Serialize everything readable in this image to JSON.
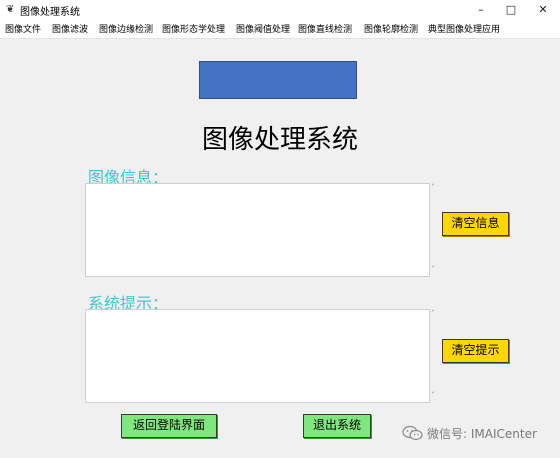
{
  "window": {
    "title": "图像处理系统",
    "icon": "feather-icon",
    "controls": {
      "minimize": "–",
      "maximize": "□",
      "close": "✕"
    }
  },
  "menu": [
    "图像文件",
    "图像滤波",
    "图像边缘检测",
    "图像形态学处理",
    "图像阈值处理",
    "图像直线检测",
    "图像轮廓检测",
    "典型图像处理应用"
  ],
  "main": {
    "title": "图像处理系统",
    "image_info_label": "图像信息：",
    "image_info_text": "",
    "system_tip_label": "系统提示：",
    "system_tip_text": "",
    "clear_info_button": "清空信息",
    "clear_tip_button": "清空提示",
    "return_login_button": "返回登陆界面",
    "exit_button": "退出系统"
  },
  "watermark": "微信号: IMAICenter",
  "colors": {
    "accent_blue": "#4472c4",
    "label_cyan": "#3cc8d0",
    "button_yellow": "#ffd700",
    "button_green": "#7ee87e"
  }
}
